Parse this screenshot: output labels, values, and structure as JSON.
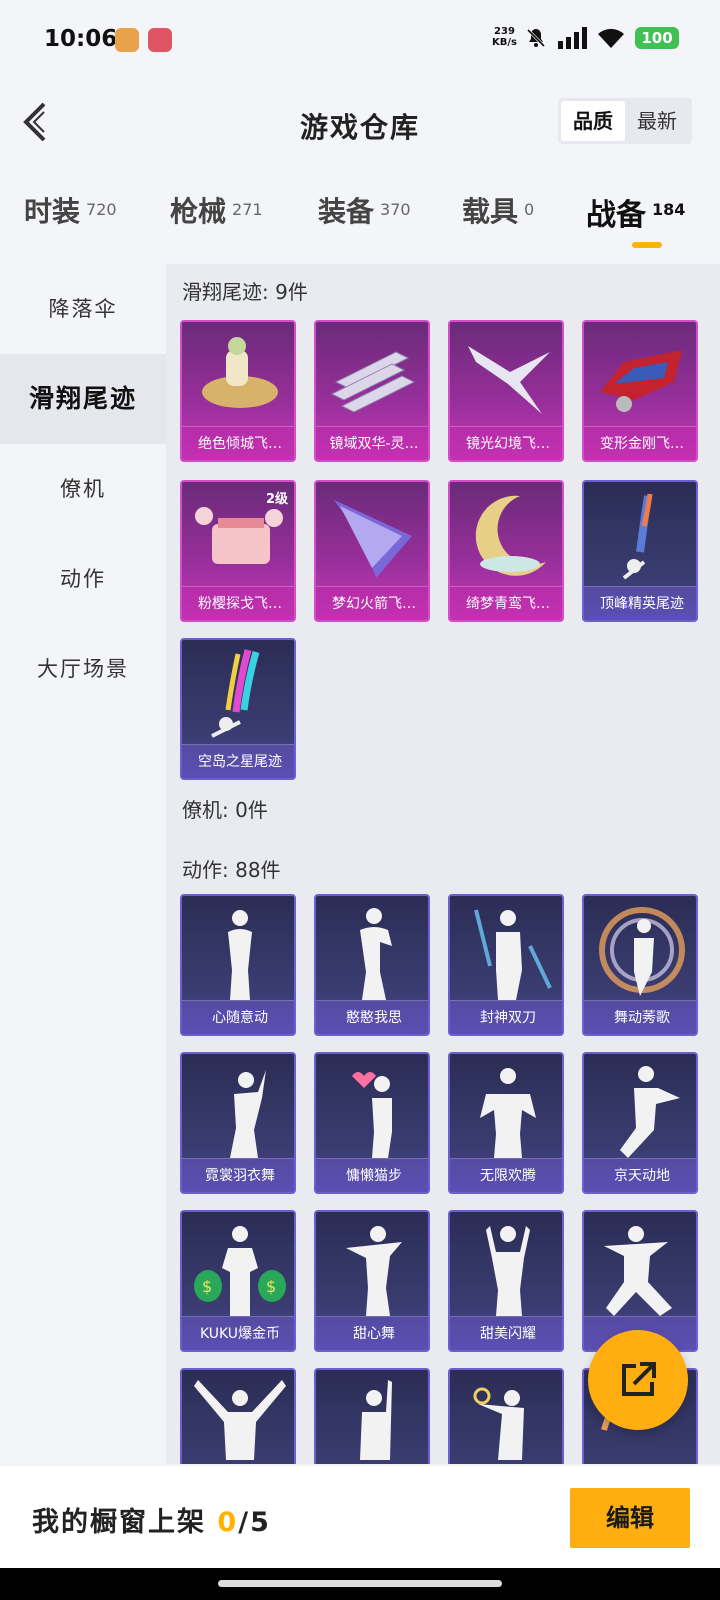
{
  "status_bar": {
    "time": "10:06",
    "net_speed_value": "239",
    "net_speed_unit": "KB/s",
    "battery": "100"
  },
  "header": {
    "title": "游戏仓库",
    "sort_options": [
      "品质",
      "最新"
    ],
    "active_sort": "品质"
  },
  "tabs": [
    {
      "label": "时装",
      "count": "720"
    },
    {
      "label": "枪械",
      "count": "271"
    },
    {
      "label": "装备",
      "count": "370"
    },
    {
      "label": "载具",
      "count": "0"
    },
    {
      "label": "战备",
      "count": "184"
    }
  ],
  "active_tab": "战备",
  "sidebar": {
    "items": [
      "降落伞",
      "滑翔尾迹",
      "僚机",
      "动作",
      "大厅场景"
    ],
    "active": "滑翔尾迹"
  },
  "sections": {
    "trails": {
      "title": "滑翔尾迹: 9件",
      "items": [
        {
          "name": "绝色倾城飞…",
          "style": "purple"
        },
        {
          "name": "镜域双华-灵…",
          "style": "purple"
        },
        {
          "name": "镜光幻境飞…",
          "style": "purple"
        },
        {
          "name": "变形金刚飞…",
          "style": "purple"
        },
        {
          "name": "粉樱探戈飞…",
          "style": "purple",
          "badge": "2级"
        },
        {
          "name": "梦幻火箭飞…",
          "style": "purple"
        },
        {
          "name": "绮梦青鸾飞…",
          "style": "purple"
        },
        {
          "name": "顶峰精英尾迹",
          "style": "navy"
        },
        {
          "name": "空岛之星尾迹",
          "style": "navy"
        }
      ]
    },
    "wingman": {
      "title": "僚机: 0件"
    },
    "emotes": {
      "title": "动作: 88件",
      "items": [
        {
          "name": "心随意动"
        },
        {
          "name": "憨憨我思"
        },
        {
          "name": "封神双刀"
        },
        {
          "name": "舞动莠歌"
        },
        {
          "name": "霓裳羽衣舞"
        },
        {
          "name": "慵懒猫步"
        },
        {
          "name": "无限欢腾"
        },
        {
          "name": "京天动地"
        },
        {
          "name": "KUKU爆金币"
        },
        {
          "name": "甜心舞"
        },
        {
          "name": "甜美闪耀"
        },
        {
          "name": ""
        }
      ]
    }
  },
  "bottom_bar": {
    "text": "我的橱窗上架",
    "shown": "0",
    "total": "/5",
    "edit_label": "编辑"
  },
  "colors": {
    "accent": "#ffae12",
    "rare_purple": "#c93dbb",
    "epic_navy": "#3b3d72"
  }
}
